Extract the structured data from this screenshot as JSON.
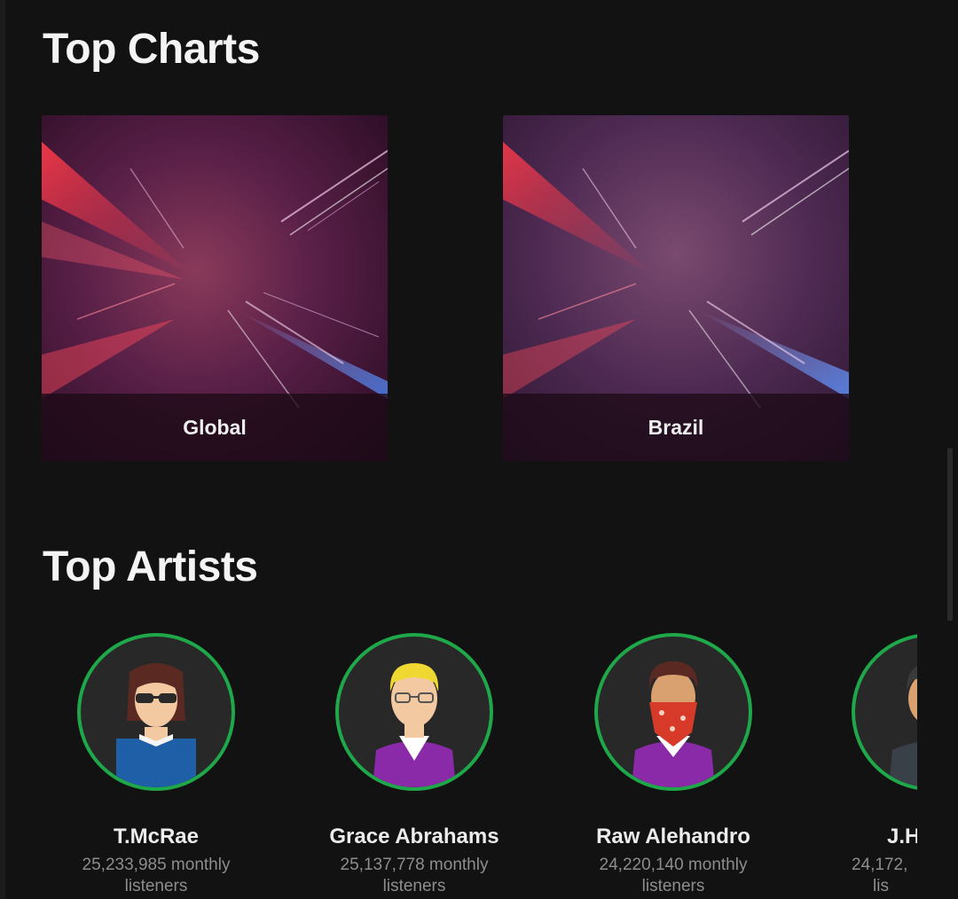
{
  "sections": {
    "top_charts": "Top Charts",
    "top_artists": "Top Artists"
  },
  "charts": [
    {
      "label": "Global"
    },
    {
      "label": "Brazil"
    }
  ],
  "artists": [
    {
      "name": "T.McRae",
      "listeners": "25,233,985 monthly listeners",
      "icon": "avatar-sunglasses-icon"
    },
    {
      "name": "Grace Abrahams",
      "listeners": "25,137,778 monthly listeners",
      "icon": "avatar-blonde-icon"
    },
    {
      "name": "Raw Alehandro",
      "listeners": "24,220,140 monthly listeners",
      "icon": "avatar-bandana-icon"
    },
    {
      "name": "J.H",
      "listeners": "24,172,",
      "listeners_tail": "lis",
      "icon": "avatar-suit-icon"
    }
  ],
  "colors": {
    "background": "#121212",
    "accent_ring": "#1fa84a",
    "text_primary": "#ececec",
    "text_secondary": "#8d8d8d"
  }
}
